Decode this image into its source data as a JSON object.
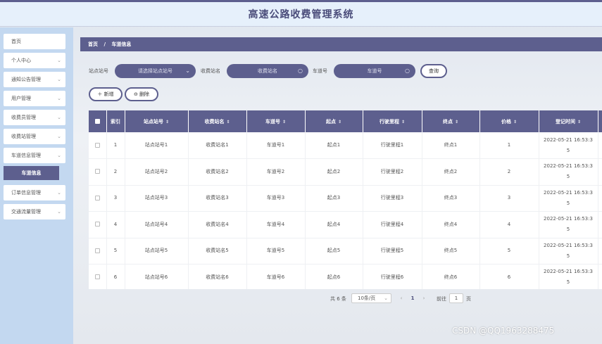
{
  "header": {
    "title": "高速公路收费管理系统"
  },
  "sidebar": {
    "items": [
      {
        "label": "首页",
        "chevron": false
      },
      {
        "label": "个人中心",
        "chevron": true
      },
      {
        "label": "通知公告管理",
        "chevron": true
      },
      {
        "label": "用户管理",
        "chevron": true
      },
      {
        "label": "收费员管理",
        "chevron": true
      },
      {
        "label": "收费站管理",
        "chevron": true
      },
      {
        "label": "车道信息管理",
        "chevron": true
      },
      {
        "label": "订单信息管理",
        "chevron": true
      },
      {
        "label": "交通流量管理",
        "chevron": true
      }
    ],
    "active_sub": "车道信息"
  },
  "breadcrumb": {
    "home": "首页",
    "separator": "/",
    "current": "车道信息"
  },
  "search": {
    "station_no_label": "站点站号",
    "station_no_placeholder": "请选择站点站号",
    "station_name_label": "收费站名",
    "station_name_placeholder": "收费站名",
    "lane_no_label": "车道号",
    "lane_no_placeholder": "车道号",
    "query_button": "查询"
  },
  "actions": {
    "add_label": "＋ 新增",
    "delete_label": "⊖ 删除"
  },
  "table": {
    "columns": [
      "索引",
      "站点站号",
      "收费站名",
      "车道号",
      "起点",
      "行驶里程",
      "终点",
      "价格",
      "登记时间"
    ],
    "rows": [
      [
        "1",
        "站点站号1",
        "收费站名1",
        "车道号1",
        "起点1",
        "行驶里程1",
        "终点1",
        "1",
        "2022-05-21 16:53:3",
        "5"
      ],
      [
        "2",
        "站点站号2",
        "收费站名2",
        "车道号2",
        "起点2",
        "行驶里程2",
        "终点2",
        "2",
        "2022-05-21 16:53:3",
        "5"
      ],
      [
        "3",
        "站点站号3",
        "收费站名3",
        "车道号3",
        "起点3",
        "行驶里程3",
        "终点3",
        "3",
        "2022-05-21 16:53:3",
        "5"
      ],
      [
        "4",
        "站点站号4",
        "收费站名4",
        "车道号4",
        "起点4",
        "行驶里程4",
        "终点4",
        "4",
        "2022-05-21 16:53:3",
        "5"
      ],
      [
        "5",
        "站点站号5",
        "收费站名5",
        "车道号5",
        "起点5",
        "行驶里程5",
        "终点5",
        "5",
        "2022-05-21 16:53:3",
        "5"
      ],
      [
        "6",
        "站点站号6",
        "收费站名6",
        "车道号6",
        "起点6",
        "行驶里程6",
        "终点6",
        "6",
        "2022-05-21 16:53:3",
        "5"
      ]
    ]
  },
  "pager": {
    "total": "共 6 条",
    "page_size": "10条/页",
    "prev": "‹",
    "current": "1",
    "next": "›",
    "goto_label": "前往",
    "goto_value": "1",
    "page_label": "页"
  },
  "watermark": "CSDN @QQ1963288475",
  "colors": {
    "accent": "#5d5f8e",
    "sidebar": "#c3d8f0",
    "header_bg": "#e6f0fb"
  },
  "icons": {
    "chevron": "chevron-down-icon",
    "search": "search-icon",
    "sort": "sort-icon"
  }
}
